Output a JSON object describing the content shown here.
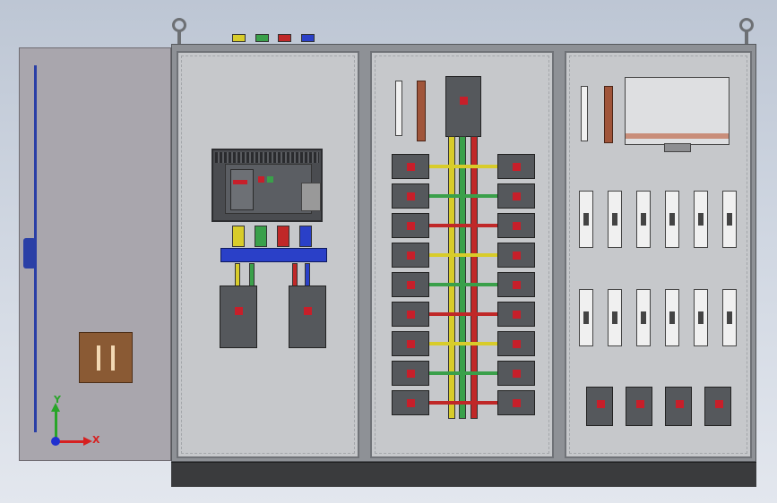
{
  "viewport": {
    "triad": {
      "x_label": "X",
      "y_label": "Y",
      "x_color": "#d62020",
      "y_color": "#28a528",
      "z_color": "#2030d0"
    }
  },
  "cabinet": {
    "terminal_colors": [
      "#d8cc2a",
      "#3aa04a",
      "#c02828",
      "#2a40c8"
    ],
    "phase_colors": [
      "#d8cc2a",
      "#3aa04a",
      "#c02828",
      "#2a40c8"
    ],
    "acb_label": "",
    "mccb_nameplate": ""
  },
  "component_colors": {
    "switch_red": "#c71f2a",
    "door_blue": "#2a3fa6",
    "handle_brown": "#8a5a34",
    "copper": "#a0553a"
  }
}
